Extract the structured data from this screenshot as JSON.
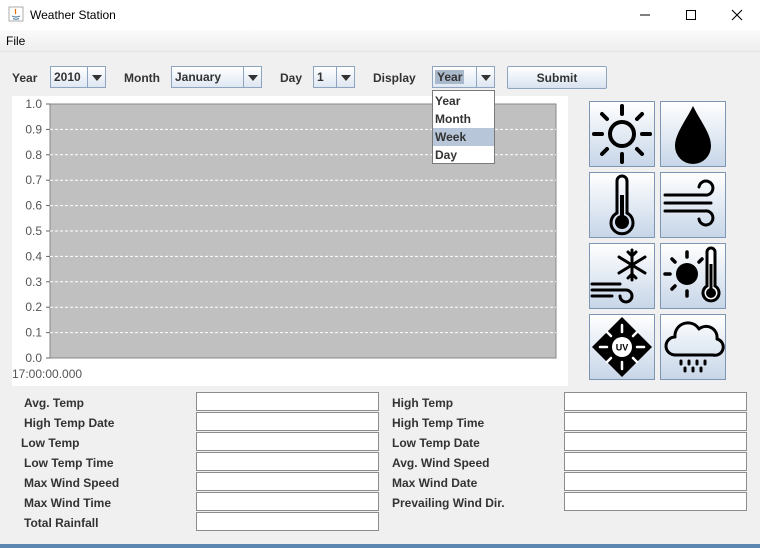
{
  "window": {
    "title": "Weather Station"
  },
  "menu": {
    "file": "File"
  },
  "controls": {
    "year_label": "Year",
    "year_value": "2010",
    "month_label": "Month",
    "month_value": "January",
    "day_label": "Day",
    "day_value": "1",
    "display_label": "Display",
    "display_value": "Year",
    "submit_label": "Submit"
  },
  "display_dropdown": {
    "options": [
      "Year",
      "Month",
      "Week",
      "Day"
    ],
    "highlighted": "Week"
  },
  "chart_data": {
    "type": "line",
    "yticks": [
      "1.0",
      "0.9",
      "0.8",
      "0.7",
      "0.6",
      "0.5",
      "0.4",
      "0.3",
      "0.2",
      "0.1",
      "0.0"
    ],
    "ylim": [
      0,
      1.0
    ],
    "x_tick_label": "17:00:00.000",
    "series": [],
    "grid": true,
    "plot_background": "#c0c0c0",
    "grid_color": "#ffffff"
  },
  "icons": [
    "sun-icon",
    "raindrop-icon",
    "thermometer-icon",
    "wind-icon",
    "snowflake-wind-icon",
    "sun-thermometer-icon",
    "uv-icon",
    "rain-cloud-icon"
  ],
  "stats_left": [
    "Avg. Temp",
    "High Temp Date",
    "Low Temp",
    "Low Temp Time",
    "Max Wind Speed",
    "Max Wind Time",
    "Total Rainfall"
  ],
  "stats_right": [
    "High Temp",
    "High Temp Time",
    "Low Temp Date",
    "Avg. Wind Speed",
    "Max Wind Date",
    "Prevailing Wind Dir."
  ],
  "colors": {
    "accent": "#5b87b0",
    "border": "#8ea4bf"
  }
}
